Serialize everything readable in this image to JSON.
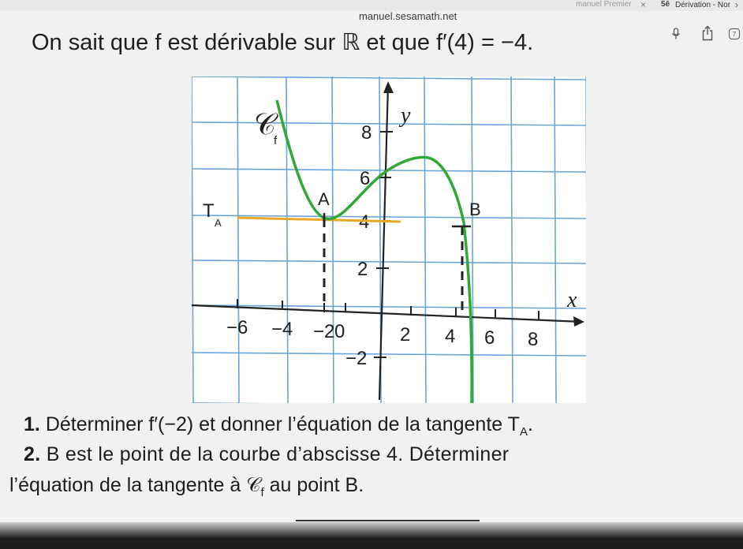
{
  "browser": {
    "prev_tab_label": "manuel Premier",
    "current_tab_label": "Dérivation - Nor",
    "url": "manuel.sesamath.net"
  },
  "exercise": {
    "title": "On sait que f est dérivable sur ℝ et que f′(4) = −4.",
    "q1_num": "1.",
    "q1_text": "Déterminer f′(−2) et donner l’équation de la tangente T",
    "q1_sub": "A",
    "q1_end": ".",
    "q2_num": "2.",
    "q2_text": "B est le point de la courbe d’abscisse 4. Déterminer",
    "q3_a": "l’équation de la tangente à 𝒞",
    "q3_sub": "f",
    "q3_b": " au point B."
  },
  "graph": {
    "curve_label": "𝒞",
    "curve_sub": "f",
    "x_axis_label": "x",
    "y_axis_label": "y",
    "tangent_label": "T",
    "tangent_sub": "A",
    "point_a_label": "A",
    "point_b_label": "B",
    "x_ticks": [
      "−6",
      "−4",
      "−2",
      "0",
      "2",
      "4",
      "6",
      "8"
    ],
    "y_ticks": [
      "8",
      "6",
      "4",
      "2",
      "−2"
    ],
    "colors": {
      "grid": "#6aa5d8",
      "curve": "#2fa836",
      "tangent": "#e7a92a",
      "axis": "#222222"
    }
  }
}
